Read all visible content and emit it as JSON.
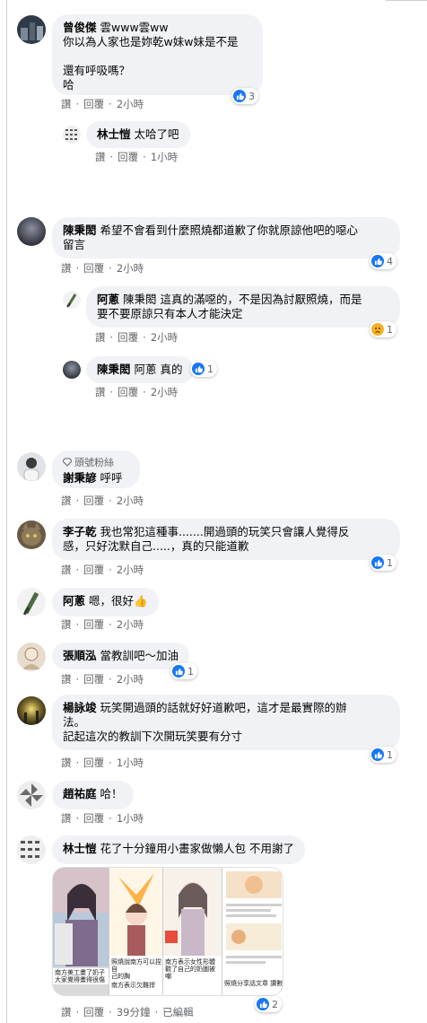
{
  "actions": {
    "like": "讚",
    "reply": "回覆",
    "sep": "·",
    "edited": "已編輯"
  },
  "fan_badge": "頭號粉絲",
  "comments": [
    {
      "name": "曾俊傑",
      "text": "雲www雲ww\n你以為人家也是妳乾w妹w妹是不是\n\n還有呼吸嗎？\n哈",
      "time": "2小時",
      "reactions": "3"
    },
    {
      "name": "林士愷",
      "text": "太哈了吧",
      "time": "1小時"
    },
    {
      "name": "陳秉閎",
      "text": "希望不會看到什麼照燒都道歉了你就原諒他吧的噁心\n留言",
      "time": "2小時",
      "reactions": "4"
    },
    {
      "name": "阿蔥",
      "tag": "陳秉閎",
      "text": "這真的滿噁的，不是因為討厭照燒，而是\n要不要原諒只有本人才能決定",
      "time": "2小時",
      "reactions": "1"
    },
    {
      "name": "陳秉閎",
      "tag": "阿蔥",
      "text": "真的",
      "time": "2小時",
      "reactions": "1"
    },
    {
      "name": "謝秉諺",
      "text": "呼呼",
      "time": "2小時"
    },
    {
      "name": "李子乾",
      "text": "我也常犯這種事.......開過頭的玩笑只會讓人覺得反\n感，只好沈默自己.....，真的只能道歉",
      "time": "2小時",
      "reactions": "1"
    },
    {
      "name": "阿蔥",
      "text": "嗯，很好",
      "emoji": "👍",
      "time": "2小時"
    },
    {
      "name": "張順泓",
      "text": "當教訓吧～加油",
      "time": "2小時",
      "reactions": "1"
    },
    {
      "name": "楊詠竣",
      "text": "玩笑開過頭的話就好好道歉吧，這才是最實際的辦\n法。\n記起這次的教訓下次開玩笑要有分寸",
      "time": "1小時",
      "reactions": "1"
    },
    {
      "name": "趙祐庭",
      "text": "哈！",
      "time": "1小時"
    },
    {
      "name": "林士愷",
      "text": "花了十分鐘用小畫家做懶人包 不用謝了",
      "time": "39分鐘",
      "reactions": "2"
    }
  ],
  "image_captions": {
    "c1": "南方美工畫了奶子\n大家覺得畫得很傷",
    "c2": "照燒說南方可以捏自\n己的胸",
    "c3": "南方表示女性形體\n觀了自己的奶圖被\n嘲",
    "c4": "南方表示欠難捍",
    "c5": "照燒分享話文章 讚數"
  },
  "colors": {
    "bubble": "#f0f2f5",
    "meta": "#65676b",
    "like": "#1877f2",
    "sad": "#f7b125",
    "text": "#050505"
  }
}
